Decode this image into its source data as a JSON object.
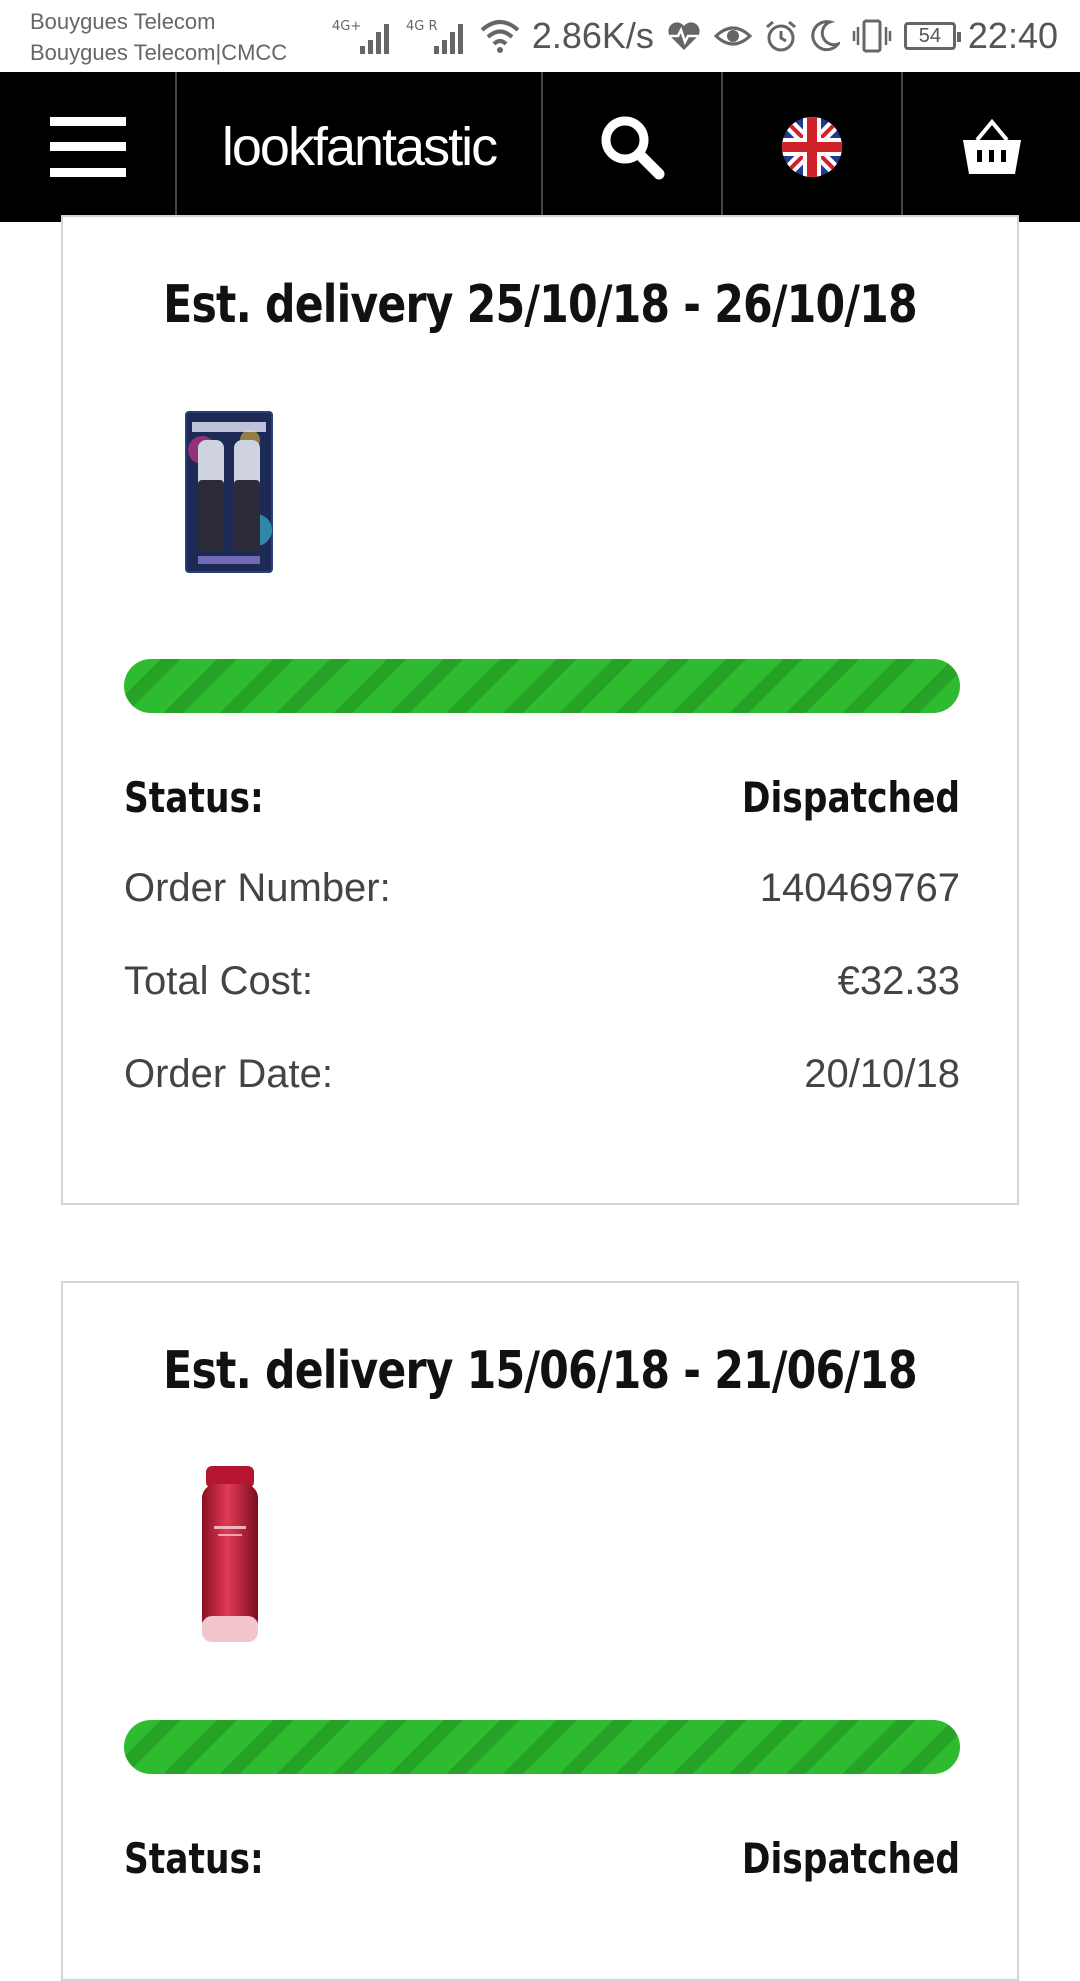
{
  "status_bar": {
    "carrier_1": "Bouygues Telecom",
    "carrier_2": "Bouygues Telecom|CMCC",
    "network_1": "4G+",
    "network_2": "4G R",
    "speed": "2.86K/s",
    "battery": "54",
    "time": "22:40"
  },
  "header": {
    "logo": "lookfantastic",
    "menu_icon": "hamburger-menu-icon",
    "search_icon": "search-icon",
    "flag_icon": "uk-flag-icon",
    "basket_icon": "basket-icon"
  },
  "orders": [
    {
      "delivery": "Est. delivery 25/10/18 - 26/10/18",
      "product_image": "all-nighter-setting-spray-duo",
      "progress": 1.0,
      "status_label": "Status:",
      "status_value": "Dispatched",
      "order_number_label": "Order Number:",
      "order_number": "140469767",
      "total_cost_label": "Total Cost:",
      "total_cost": "€32.33",
      "order_date_label": "Order Date:",
      "order_date": "20/10/18"
    },
    {
      "delivery": "Est. delivery 15/06/18 - 21/06/18",
      "product_image": "red-serum-bottle",
      "progress": 1.0,
      "status_label": "Status:",
      "status_value": "Dispatched"
    }
  ],
  "colors": {
    "header_bg": "#000000",
    "progress_green": "#2fbb2f",
    "card_border": "#d4d4d4"
  }
}
